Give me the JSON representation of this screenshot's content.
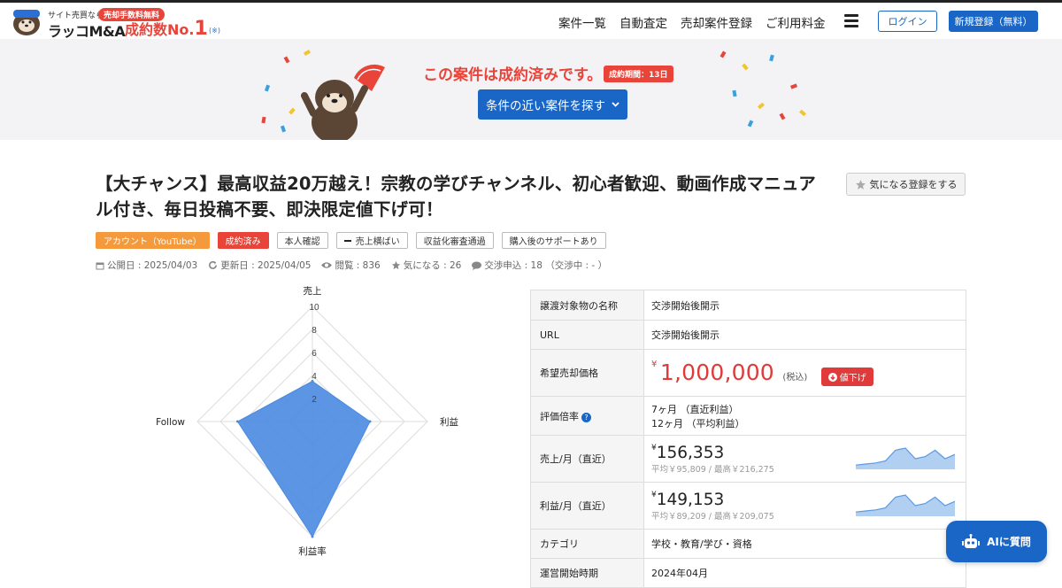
{
  "header": {
    "logo_small": "サイト売買なら",
    "logo_badge": "売却手数料無料",
    "logo_main": "ラッコM&A",
    "logo_count_text": "成約数No.",
    "logo_count_num": "1",
    "logo_note": "(※)",
    "nav": [
      "案件一覧",
      "自動査定",
      "売却案件登録",
      "ご利用料金"
    ],
    "login": "ログイン",
    "register": "新規登録（無料）"
  },
  "banner": {
    "message": "この案件は成約済みです。",
    "badge": "成約期間：13日",
    "button": "条件の近い案件を探す"
  },
  "listing": {
    "title": "【大チャンス】最高収益20万越え！宗教の学びチャンネル、初心者歓迎、動画作成マニュアル付き、毎日投稿不要、即決限定値下げ可！",
    "fav_button": "気になる登録をする",
    "tags": [
      {
        "label": "アカウント（YouTube）",
        "style": "orange"
      },
      {
        "label": "成約済み",
        "style": "red"
      },
      {
        "label": "本人確認",
        "style": "plain"
      },
      {
        "label": "売上横ばい",
        "style": "plain",
        "icon": "dash-icon"
      },
      {
        "label": "収益化審査通過",
        "style": "plain"
      },
      {
        "label": "購入後のサポートあり",
        "style": "plain"
      }
    ],
    "meta": {
      "published": "公開日 : 2025/04/03",
      "updated": "更新日 : 2025/04/05",
      "views": "閲覧 : 836",
      "favorites": "気になる : 26",
      "negotiations": "交渉申込 : 18 （交渉中 : - ）"
    }
  },
  "chart_data": {
    "type": "radar",
    "axes": [
      "売上",
      "利益",
      "利益率",
      "Follow"
    ],
    "ticks": [
      "2",
      "4",
      "6",
      "8",
      "10"
    ],
    "range": [
      0,
      10
    ],
    "values": [
      3.5,
      5,
      10,
      6.5
    ],
    "color": "#4a8ae0"
  },
  "table": {
    "rows": [
      {
        "label": "譲渡対象物の名称",
        "value": "交渉開始後開示"
      },
      {
        "label": "URL",
        "value": "交渉開始後開示"
      }
    ],
    "price": {
      "label": "希望売却価格",
      "yen": "¥",
      "value": "1,000,000",
      "tax": "(税込)",
      "down": "値下げ"
    },
    "multiple": {
      "label": "評価倍率",
      "help": "?",
      "line1": "7ヶ月 （直近利益）",
      "line2": "12ヶ月 （平均利益）"
    },
    "sales": {
      "label": "売上/月（直近）",
      "yen": "¥",
      "value": "156,353",
      "sub": "平均￥95,809 / 最高￥216,275",
      "spark": [
        2,
        2.5,
        3,
        4,
        9,
        10,
        5,
        6,
        9,
        5,
        7
      ]
    },
    "profit": {
      "label": "利益/月（直近）",
      "yen": "¥",
      "value": "149,153",
      "sub": "平均￥89,209 / 最高￥209,075",
      "spark": [
        2,
        2.5,
        3,
        4,
        9,
        10,
        5,
        6,
        9,
        5,
        7
      ]
    },
    "category": {
      "label": "カテゴリ",
      "value": "学校・教育/学び・資格"
    },
    "start": {
      "label": "運営開始時期",
      "value": "2024年04月"
    }
  },
  "ai_button": "AIに質問",
  "colors": {
    "brand_blue": "#1a66c7",
    "accent_red": "#e8443a",
    "tag_orange": "#f59a3c"
  }
}
